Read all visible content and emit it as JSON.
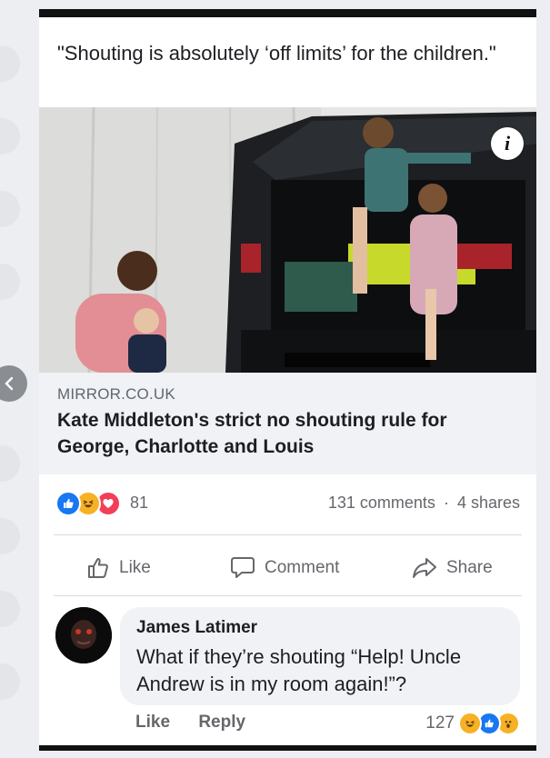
{
  "post": {
    "text": "\"Shouting is absolutely ‘off limits’ for the children.\""
  },
  "link": {
    "domain": "MIRROR.CO.UK",
    "title": "Kate Middleton's strict no shouting rule for George, Charlotte and Louis",
    "info_label": "i"
  },
  "reactions": {
    "count": "81",
    "types": [
      "like-icon",
      "haha-icon",
      "love-icon"
    ]
  },
  "stats": {
    "comments": "131 comments",
    "separator": "·",
    "shares": "4 shares"
  },
  "actions": {
    "like": "Like",
    "comment": "Comment",
    "share": "Share"
  },
  "comment": {
    "author": "James Latimer",
    "text": "What if they’re shouting “Help! Uncle Andrew is in my room again!”?",
    "like": "Like",
    "reply": "Reply",
    "reaction_count": "127",
    "reaction_types": [
      "haha-icon",
      "like-icon",
      "wow-icon"
    ]
  },
  "colors": {
    "accent": "#1877f2",
    "love": "#f33e58",
    "haha": "#f7b125",
    "text_secondary": "#65676b",
    "link_bg": "#f0f2f5"
  }
}
